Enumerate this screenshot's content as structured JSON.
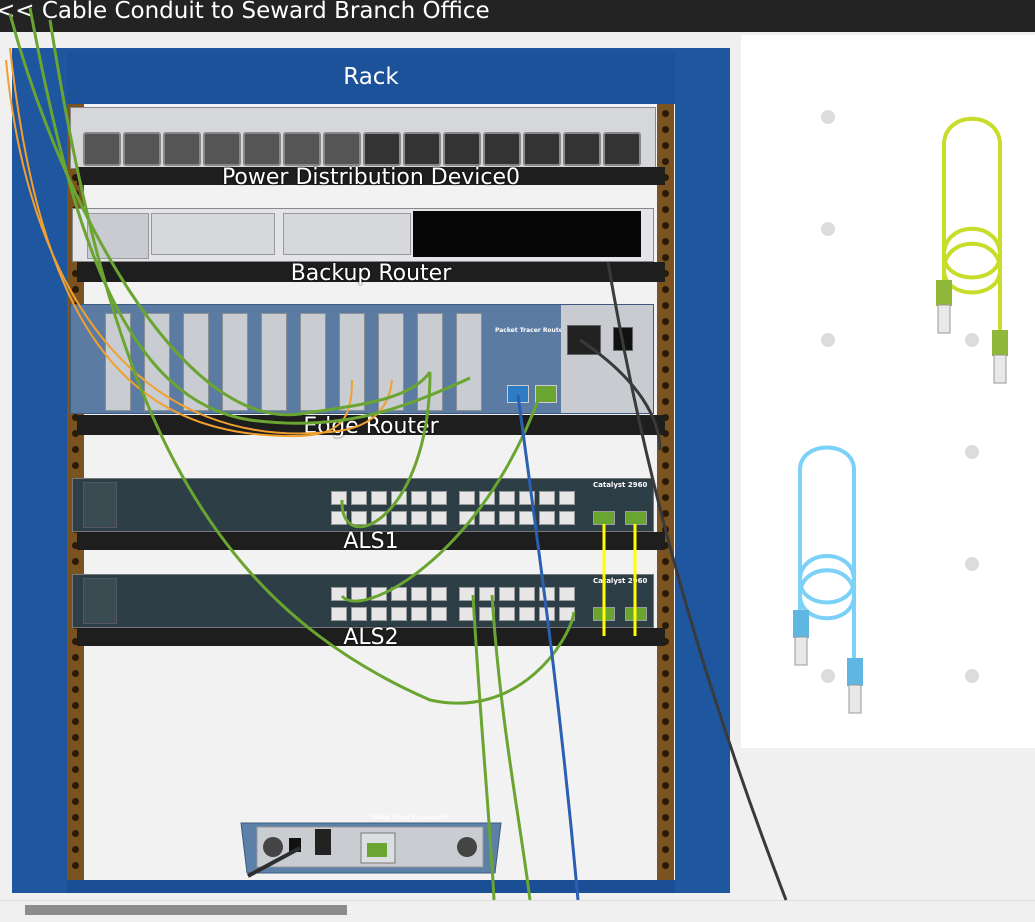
{
  "header": {
    "title": "<< Cable Conduit to Seward Branch Office"
  },
  "rack": {
    "title": "Rack",
    "devices": [
      {
        "label": "Power Distribution Device0"
      },
      {
        "label": "Backup  Router"
      },
      {
        "label": "Edge  Router"
      },
      {
        "label": "ALS1"
      },
      {
        "label": "ALS2"
      }
    ]
  },
  "router_panel": {
    "brand": "Packet Tracer Router"
  },
  "switch_panel": {
    "model": "Catalyst 2960"
  },
  "accesspoint": {
    "brand": "Packet Tracer Accesspoint"
  },
  "colors": {
    "rack_blue": "#1e56a0",
    "straight_cable": "#6aa531",
    "fiber_cable": "#f0a030",
    "console_cable": "#2b5fb2",
    "power_cable": "#3a3a3a",
    "crossover_cable": "#ffff00",
    "spare_green": "#c8dc2a",
    "spare_blue": "#7bd1f7"
  },
  "icons": [
    "power-outlet-icon",
    "power-switch-icon",
    "rj45-connector-icon"
  ]
}
